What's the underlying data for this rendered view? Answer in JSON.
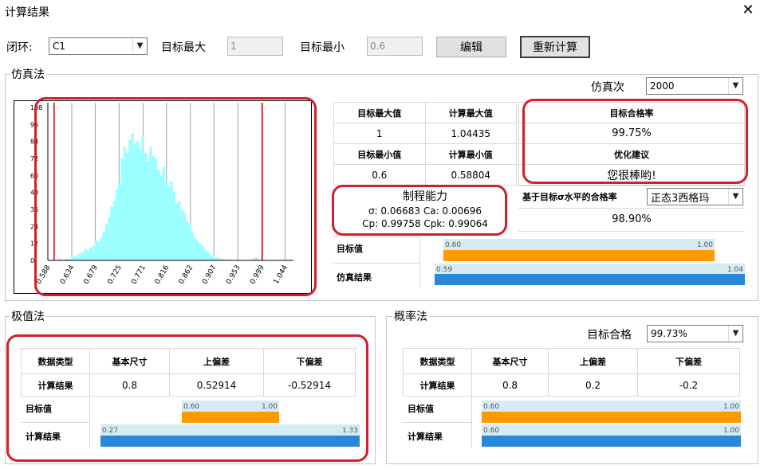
{
  "window": {
    "title": "计算结果",
    "close": "✕"
  },
  "top": {
    "loop_label": "闭环:",
    "loop_value": "C1",
    "target_max_label": "目标最大",
    "target_max_value": "1",
    "target_min_label": "目标最小",
    "target_min_value": "0.6",
    "edit_button": "编辑",
    "recalc_button": "重新计算"
  },
  "sim": {
    "legend": "仿真法",
    "iter_label": "仿真次",
    "iter_value": "2000",
    "t_target_max_label": "目标最大值",
    "t_calc_max_label": "计算最大值",
    "t_target_max": "1",
    "t_calc_max": "1.04435",
    "t_target_min_label": "目标最小值",
    "t_calc_min_label": "计算最小值",
    "t_target_min": "0.6",
    "t_calc_min": "0.58804",
    "pass_rate_label": "目标合格率",
    "pass_rate": "99.75%",
    "advice_label": "优化建议",
    "advice": "您很棒哟!",
    "capability_title": "制程能力",
    "cap_line1": "σ: 0.06683 Ca: 0.00696",
    "cap_line2": "Cp: 0.99758 Cpk: 0.99064",
    "sigma_rate_label": "基于目标σ水平的合格率",
    "sigma_combo": "正态3西格玛",
    "sigma_rate": "98.90%",
    "target_row_label": "目标值",
    "result_row_label": "仿真结果",
    "target_bar_min": "0.60",
    "target_bar_max": "1.00",
    "result_bar_min": "0.59",
    "result_bar_max": "1.04"
  },
  "extreme": {
    "legend": "极值法",
    "h_type": "数据类型",
    "h_base": "基本尺寸",
    "h_upper": "上偏差",
    "h_lower": "下偏差",
    "row_label": "计算结果",
    "base": "0.8",
    "upper": "0.52914",
    "lower": "-0.52914",
    "target_row_label": "目标值",
    "result_row_label": "计算结果",
    "target_bar_min": "0.60",
    "target_bar_max": "1.00",
    "result_bar_min": "0.27",
    "result_bar_max": "1.33"
  },
  "prob": {
    "legend": "概率法",
    "goal_label": "目标合格",
    "goal_value": "99.73%",
    "h_type": "数据类型",
    "h_base": "基本尺寸",
    "h_upper": "上偏差",
    "h_lower": "下偏差",
    "row_label": "计算结果",
    "base": "0.8",
    "upper": "0.2",
    "lower": "-0.2",
    "target_row_label": "目标值",
    "result_row_label": "计算结果",
    "target_bar_min": "0.60",
    "target_bar_max": "1.00",
    "result_bar_min": "0.60",
    "result_bar_max": "1.00"
  },
  "colors": {
    "histogram": "#99ffff",
    "limit_line": "#cc0000",
    "highlight_ring": "#d0202c",
    "orange_bar": "#ff9900",
    "blue_bar": "#2a88d8"
  },
  "chart_data": {
    "type": "bar",
    "xlabel": "",
    "ylabel": "",
    "x_ticks": [
      "0.588",
      "0.634",
      "0.679",
      "0.725",
      "0.771",
      "0.816",
      "0.862",
      "0.907",
      "0.953",
      "0.999",
      "1.044"
    ],
    "y_ticks": [
      0,
      12,
      24,
      36,
      48,
      60,
      72,
      84,
      96,
      108
    ],
    "ylim": [
      0,
      108
    ],
    "xlim": [
      0.588,
      1.06
    ],
    "limits": [
      0.6,
      1.0
    ],
    "bin_start": 0.588,
    "bin_width": 0.005,
    "values": [
      0,
      0,
      0,
      0,
      1,
      0,
      1,
      1,
      1,
      2,
      3,
      4,
      5,
      6,
      8,
      7,
      9,
      10,
      14,
      13,
      16,
      20,
      26,
      30,
      38,
      42,
      50,
      55,
      72,
      80,
      76,
      85,
      90,
      82,
      84,
      78,
      88,
      76,
      70,
      80,
      74,
      72,
      64,
      60,
      66,
      56,
      52,
      56,
      48,
      40,
      42,
      36,
      34,
      28,
      26,
      20,
      16,
      14,
      12,
      10,
      8,
      6,
      4,
      3,
      2,
      2,
      1,
      1,
      0,
      0,
      0,
      0,
      0,
      0,
      0,
      0,
      0,
      0,
      0,
      2,
      2,
      0,
      0,
      0,
      0,
      0,
      0,
      0,
      0,
      0,
      0,
      0,
      0,
      0,
      0
    ]
  }
}
